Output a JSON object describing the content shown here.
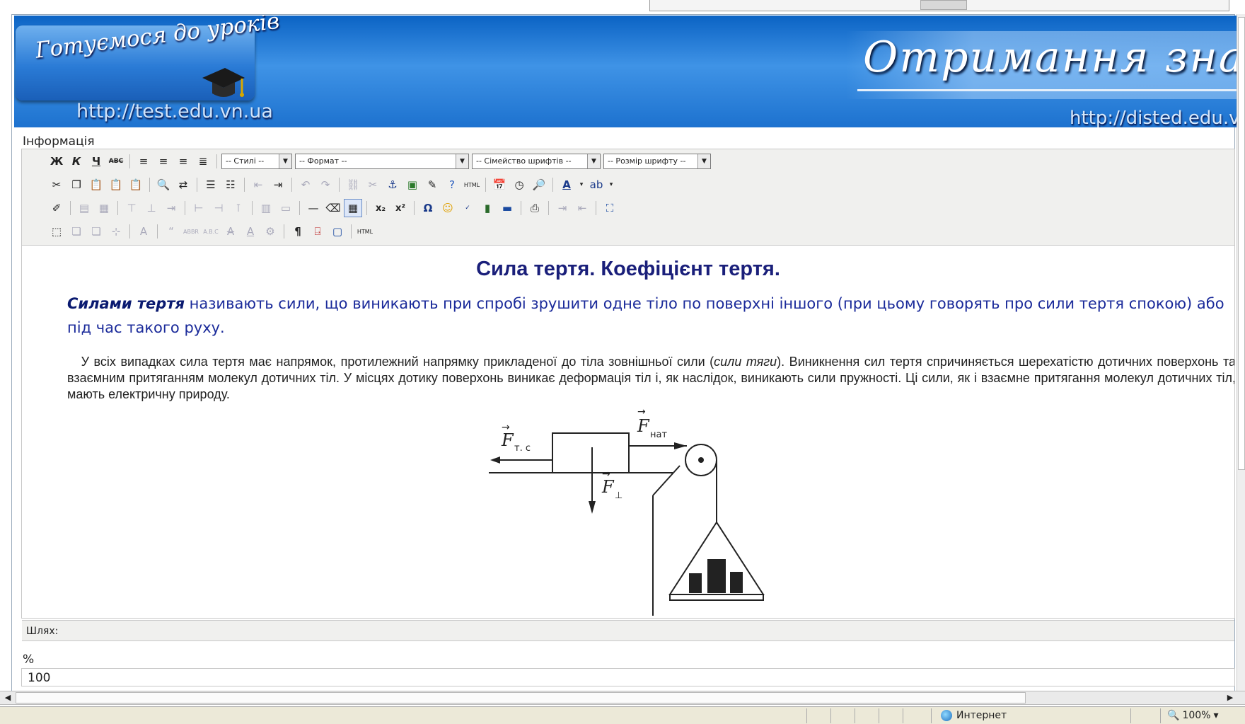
{
  "banner": {
    "logo_title": "Готуємося до уроків",
    "url_left": "http://test.edu.vn.ua",
    "headline": "Отримання знан",
    "url_right": "http://disted.edu.vn"
  },
  "form": {
    "info_label": "Інформація",
    "path_label": "Шлях:",
    "percent_label": "%",
    "percent_value": "100"
  },
  "toolbar": {
    "styles_select": "-- Стилі --",
    "format_select": "-- Формат --",
    "font_family_select": "-- Сімейство шрифтів --",
    "font_size_select": "-- Розмір шрифту --",
    "bold": "Ж",
    "italic": "К",
    "underline": "Ч",
    "strikethrough": "ABC",
    "html_label": "HTML",
    "omega": "Ω",
    "pilcrow": "¶"
  },
  "document": {
    "title": "Сила тертя. Коефіцієнт тертя.",
    "p1_lead": "Силами тертя",
    "p1_rest": " називають сили, що виникають при спробі зрушити одне тіло по поверхні іншого (при цьому говорять про сили тертя спокою) або під час такого руху.",
    "p2_start": "У всіх випадках сила тертя має напрямок, протилежний напрямку прикладеної до тіла зовнішньої сили (",
    "p2_italic": "сили тяги",
    "p2_end": ").  Виникнення сил тертя спричиняється шерехатістю дотичних поверхонь та взаємним притяганням молекул дотичних тіл. У місцях дотику поверхонь виникає деформація тіл і, як наслідок, виникають сили пружності. Ці сили, як і взаємне притягання молекул дотичних тіл, мають електричну природу.",
    "diagram_labels": {
      "friction": "F",
      "friction_sub": "т. с",
      "tension": "F",
      "tension_sub": "нат",
      "normal": "F",
      "normal_sub": "⊥"
    }
  },
  "statusbar": {
    "zone": "Интернет",
    "zoom": "100%"
  }
}
